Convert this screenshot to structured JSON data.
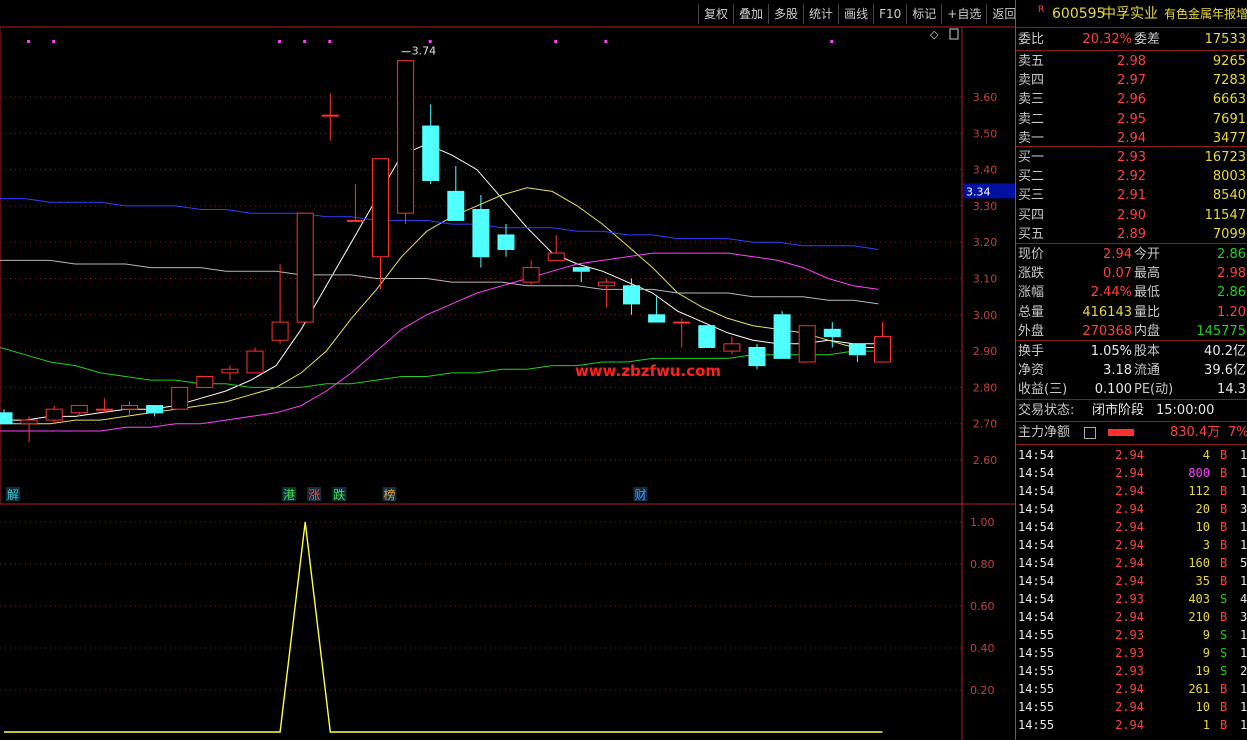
{
  "toolbar": [
    "复权",
    "叠加",
    "多股",
    "统计",
    "画线",
    "F10",
    "标记",
    "+自选",
    "返回"
  ],
  "header": {
    "r_mark": "R",
    "code": "600595",
    "name": "中孚实业",
    "tag": "有色金属年报增"
  },
  "order_ratio": {
    "label1": "委比",
    "value1": "20.32%",
    "label2": "委差",
    "value2": "17533"
  },
  "asks": [
    {
      "label": "卖五",
      "price": "2.98",
      "vol": "9265"
    },
    {
      "label": "卖四",
      "price": "2.97",
      "vol": "7283"
    },
    {
      "label": "卖三",
      "price": "2.96",
      "vol": "6663"
    },
    {
      "label": "卖二",
      "price": "2.95",
      "vol": "7691"
    },
    {
      "label": "卖一",
      "price": "2.94",
      "vol": "3477"
    }
  ],
  "bids": [
    {
      "label": "买一",
      "price": "2.93",
      "vol": "16723"
    },
    {
      "label": "买二",
      "price": "2.92",
      "vol": "8003"
    },
    {
      "label": "买三",
      "price": "2.91",
      "vol": "8540"
    },
    {
      "label": "买四",
      "price": "2.90",
      "vol": "11547"
    },
    {
      "label": "买五",
      "price": "2.89",
      "vol": "7099"
    }
  ],
  "quote": [
    {
      "l1": "现价",
      "v1": "2.94",
      "c1": "red",
      "l2": "今开",
      "v2": "2.86",
      "c2": "green"
    },
    {
      "l1": "涨跌",
      "v1": "0.07",
      "c1": "red",
      "l2": "最高",
      "v2": "2.98",
      "c2": "red"
    },
    {
      "l1": "涨幅",
      "v1": "2.44%",
      "c1": "red",
      "l2": "最低",
      "v2": "2.86",
      "c2": "green"
    },
    {
      "l1": "总量",
      "v1": "416143",
      "c1": "yel",
      "l2": "量比",
      "v2": "1.20",
      "c2": "red"
    },
    {
      "l1": "外盘",
      "v1": "270368",
      "c1": "red",
      "l2": "内盘",
      "v2": "145775",
      "c2": "green"
    }
  ],
  "fundamentals": [
    {
      "l1": "换手",
      "v1": "1.05%",
      "l2": "股本",
      "v2": "40.2亿"
    },
    {
      "l1": "净资",
      "v1": "3.18",
      "l2": "流通",
      "v2": "39.6亿"
    },
    {
      "l1": "收益(三)",
      "v1": "0.100",
      "l2": "PE(动)",
      "v2": "14.3"
    }
  ],
  "trade_status": {
    "label": "交易状态:",
    "phase": "闭市阶段",
    "time": "15:00:00"
  },
  "net_flow": {
    "label": "主力净额",
    "value": "830.4万",
    "pct": "7%"
  },
  "ticks": [
    {
      "time": "14:54",
      "price": "2.94",
      "pc": "red",
      "vol": "4",
      "vc": "yel",
      "side": "B",
      "n": "1"
    },
    {
      "time": "14:54",
      "price": "2.94",
      "pc": "red",
      "vol": "800",
      "vc": "mag",
      "side": "B",
      "n": "1"
    },
    {
      "time": "14:54",
      "price": "2.94",
      "pc": "red",
      "vol": "112",
      "vc": "yel",
      "side": "B",
      "n": "1"
    },
    {
      "time": "14:54",
      "price": "2.94",
      "pc": "red",
      "vol": "20",
      "vc": "yel",
      "side": "B",
      "n": "3"
    },
    {
      "time": "14:54",
      "price": "2.94",
      "pc": "red",
      "vol": "10",
      "vc": "yel",
      "side": "B",
      "n": "1"
    },
    {
      "time": "14:54",
      "price": "2.94",
      "pc": "red",
      "vol": "3",
      "vc": "yel",
      "side": "B",
      "n": "1"
    },
    {
      "time": "14:54",
      "price": "2.94",
      "pc": "red",
      "vol": "160",
      "vc": "yel",
      "side": "B",
      "n": "5"
    },
    {
      "time": "14:54",
      "price": "2.94",
      "pc": "red",
      "vol": "35",
      "vc": "yel",
      "side": "B",
      "n": "1"
    },
    {
      "time": "14:54",
      "price": "2.93",
      "pc": "red",
      "vol": "403",
      "vc": "yel",
      "side": "S",
      "n": "4"
    },
    {
      "time": "14:54",
      "price": "2.94",
      "pc": "red",
      "vol": "210",
      "vc": "yel",
      "side": "B",
      "n": "3"
    },
    {
      "time": "14:55",
      "price": "2.93",
      "pc": "red",
      "vol": "9",
      "vc": "yel",
      "side": "S",
      "n": "1"
    },
    {
      "time": "14:55",
      "price": "2.93",
      "pc": "red",
      "vol": "9",
      "vc": "yel",
      "side": "S",
      "n": "1"
    },
    {
      "time": "14:55",
      "price": "2.93",
      "pc": "red",
      "vol": "19",
      "vc": "yel",
      "side": "S",
      "n": "2"
    },
    {
      "time": "14:55",
      "price": "2.94",
      "pc": "red",
      "vol": "261",
      "vc": "yel",
      "side": "B",
      "n": "1"
    },
    {
      "time": "14:55",
      "price": "2.94",
      "pc": "red",
      "vol": "10",
      "vc": "yel",
      "side": "B",
      "n": "1"
    },
    {
      "time": "14:55",
      "price": "2.94",
      "pc": "red",
      "vol": "1",
      "vc": "yel",
      "side": "B",
      "n": "1"
    }
  ],
  "watermark": "www.zbzfwu.com",
  "chart_data": {
    "type": "candlestick",
    "price_axis": {
      "min": 2.6,
      "max": 3.6,
      "ticks": [
        3.6,
        3.5,
        3.4,
        3.3,
        3.2,
        3.1,
        3.0,
        2.9,
        2.8,
        2.7,
        2.6
      ],
      "cursor_label": "3.34"
    },
    "high_annotation": "3.74",
    "candles": [
      {
        "o": 2.73,
        "h": 2.74,
        "l": 2.7,
        "c": 2.7
      },
      {
        "o": 2.7,
        "h": 2.72,
        "l": 2.65,
        "c": 2.71
      },
      {
        "o": 2.71,
        "h": 2.75,
        "l": 2.7,
        "c": 2.74
      },
      {
        "o": 2.73,
        "h": 2.75,
        "l": 2.72,
        "c": 2.75
      },
      {
        "o": 2.74,
        "h": 2.77,
        "l": 2.73,
        "c": 2.74
      },
      {
        "o": 2.74,
        "h": 2.76,
        "l": 2.72,
        "c": 2.75
      },
      {
        "o": 2.75,
        "h": 2.74,
        "l": 2.72,
        "c": 2.73
      },
      {
        "o": 2.74,
        "h": 2.8,
        "l": 2.74,
        "c": 2.8
      },
      {
        "o": 2.8,
        "h": 2.83,
        "l": 2.8,
        "c": 2.83
      },
      {
        "o": 2.84,
        "h": 2.86,
        "l": 2.82,
        "c": 2.85
      },
      {
        "o": 2.84,
        "h": 2.91,
        "l": 2.84,
        "c": 2.9
      },
      {
        "o": 2.93,
        "h": 3.14,
        "l": 2.92,
        "c": 2.98
      },
      {
        "o": 2.98,
        "h": 3.28,
        "l": 2.98,
        "c": 3.28
      },
      {
        "o": 3.55,
        "h": 3.61,
        "l": 3.48,
        "c": 3.55
      },
      {
        "o": 3.26,
        "h": 3.36,
        "l": 3.26,
        "c": 3.26
      },
      {
        "o": 3.16,
        "h": 3.43,
        "l": 3.07,
        "c": 3.43
      },
      {
        "o": 3.28,
        "h": 3.7,
        "l": 3.25,
        "c": 3.7
      },
      {
        "o": 3.52,
        "h": 3.58,
        "l": 3.36,
        "c": 3.37
      },
      {
        "o": 3.34,
        "h": 3.41,
        "l": 3.26,
        "c": 3.26
      },
      {
        "o": 3.29,
        "h": 3.33,
        "l": 3.13,
        "c": 3.16
      },
      {
        "o": 3.22,
        "h": 3.25,
        "l": 3.16,
        "c": 3.18
      },
      {
        "o": 3.09,
        "h": 3.15,
        "l": 3.08,
        "c": 3.13
      },
      {
        "o": 3.15,
        "h": 3.22,
        "l": 3.15,
        "c": 3.17
      },
      {
        "o": 3.13,
        "h": 3.12,
        "l": 3.09,
        "c": 3.12
      },
      {
        "o": 3.08,
        "h": 3.1,
        "l": 3.02,
        "c": 3.09
      },
      {
        "o": 3.08,
        "h": 3.1,
        "l": 3.0,
        "c": 3.03
      },
      {
        "o": 3.0,
        "h": 3.05,
        "l": 2.98,
        "c": 2.98
      },
      {
        "o": 2.98,
        "h": 2.99,
        "l": 2.91,
        "c": 2.98
      },
      {
        "o": 2.97,
        "h": 2.97,
        "l": 2.91,
        "c": 2.91
      },
      {
        "o": 2.9,
        "h": 2.94,
        "l": 2.89,
        "c": 2.92
      },
      {
        "o": 2.91,
        "h": 2.92,
        "l": 2.85,
        "c": 2.86
      },
      {
        "o": 3.0,
        "h": 3.01,
        "l": 2.88,
        "c": 2.88
      },
      {
        "o": 2.87,
        "h": 2.97,
        "l": 2.87,
        "c": 2.97
      },
      {
        "o": 2.96,
        "h": 2.98,
        "l": 2.91,
        "c": 2.94
      },
      {
        "o": 2.92,
        "h": 2.92,
        "l": 2.87,
        "c": 2.89
      },
      {
        "o": 2.87,
        "h": 2.98,
        "l": 2.87,
        "c": 2.94
      }
    ],
    "ma_series": [
      {
        "color": "#ffffff",
        "values": [
          2.71,
          2.71,
          2.72,
          2.72,
          2.73,
          2.74,
          2.74,
          2.75,
          2.77,
          2.79,
          2.82,
          2.86,
          2.96,
          3.08,
          3.2,
          3.32,
          3.44,
          3.47,
          3.44,
          3.4,
          3.32,
          3.24,
          3.17,
          3.14,
          3.12,
          3.09,
          3.06,
          3.01,
          2.98,
          2.95,
          2.93,
          2.92,
          2.92,
          2.93,
          2.92,
          2.92
        ]
      },
      {
        "color": "#e8e060",
        "values": [
          2.7,
          2.7,
          2.7,
          2.71,
          2.71,
          2.72,
          2.73,
          2.74,
          2.75,
          2.76,
          2.78,
          2.8,
          2.84,
          2.9,
          2.99,
          3.07,
          3.16,
          3.23,
          3.27,
          3.3,
          3.33,
          3.35,
          3.34,
          3.3,
          3.25,
          3.19,
          3.13,
          3.06,
          3.02,
          2.99,
          2.97,
          2.96,
          2.95,
          2.93,
          2.91,
          2.91
        ]
      },
      {
        "color": "#ff40ff",
        "values": [
          2.68,
          2.68,
          2.68,
          2.68,
          2.68,
          2.69,
          2.69,
          2.7,
          2.7,
          2.71,
          2.72,
          2.73,
          2.75,
          2.79,
          2.84,
          2.9,
          2.96,
          3.0,
          3.03,
          3.06,
          3.08,
          3.1,
          3.12,
          3.14,
          3.15,
          3.16,
          3.17,
          3.17,
          3.17,
          3.17,
          3.16,
          3.15,
          3.13,
          3.1,
          3.08,
          3.07
        ]
      },
      {
        "color": "#20d020",
        "values": [
          2.91,
          2.89,
          2.87,
          2.86,
          2.84,
          2.83,
          2.82,
          2.82,
          2.81,
          2.81,
          2.8,
          2.8,
          2.8,
          2.81,
          2.81,
          2.82,
          2.83,
          2.83,
          2.84,
          2.84,
          2.85,
          2.85,
          2.86,
          2.86,
          2.87,
          2.87,
          2.88,
          2.88,
          2.88,
          2.88,
          2.89,
          2.89,
          2.89,
          2.89,
          2.9,
          2.9
        ]
      },
      {
        "color": "#3040ff",
        "values": [
          3.32,
          3.32,
          3.31,
          3.31,
          3.31,
          3.3,
          3.3,
          3.3,
          3.29,
          3.29,
          3.28,
          3.28,
          3.28,
          3.27,
          3.27,
          3.26,
          3.26,
          3.26,
          3.25,
          3.25,
          3.24,
          3.24,
          3.24,
          3.23,
          3.23,
          3.22,
          3.22,
          3.21,
          3.21,
          3.21,
          3.2,
          3.2,
          3.19,
          3.19,
          3.19,
          3.18
        ]
      },
      {
        "color": "#b8b8b8",
        "values": [
          3.15,
          3.15,
          3.15,
          3.14,
          3.14,
          3.14,
          3.13,
          3.13,
          3.13,
          3.12,
          3.12,
          3.12,
          3.11,
          3.11,
          3.11,
          3.1,
          3.1,
          3.1,
          3.09,
          3.09,
          3.09,
          3.08,
          3.08,
          3.08,
          3.07,
          3.07,
          3.07,
          3.06,
          3.06,
          3.06,
          3.05,
          3.05,
          3.05,
          3.04,
          3.04,
          3.03
        ]
      }
    ],
    "event_markers": [
      {
        "i": 0,
        "label": "解",
        "color": "#40c0c0"
      },
      {
        "i": 11,
        "label": "港",
        "color": "#40e040"
      },
      {
        "i": 12,
        "label": "涨",
        "color": "#ff4040"
      },
      {
        "i": 13,
        "label": "跌",
        "color": "#40e040"
      },
      {
        "i": 15,
        "label": "榜",
        "color": "#e8a040"
      },
      {
        "i": 25,
        "label": "财",
        "color": "#6080ff"
      }
    ],
    "dot_markers": [
      1,
      2,
      11,
      12,
      13,
      17,
      22,
      24,
      33
    ],
    "indicator": {
      "axis_ticks": [
        1.0,
        0.8,
        0.6,
        0.4,
        0.2
      ],
      "axis_labels": [
        "1.00",
        "0.80",
        "0.60",
        "0.40",
        "0.20"
      ],
      "values": [
        0,
        0,
        0,
        0,
        0,
        0,
        0,
        0,
        0,
        0,
        0,
        0,
        1,
        0,
        0,
        0,
        0,
        0,
        0,
        0,
        0,
        0,
        0,
        0,
        0,
        0,
        0,
        0,
        0,
        0,
        0,
        0,
        0,
        0,
        0,
        0
      ]
    }
  }
}
